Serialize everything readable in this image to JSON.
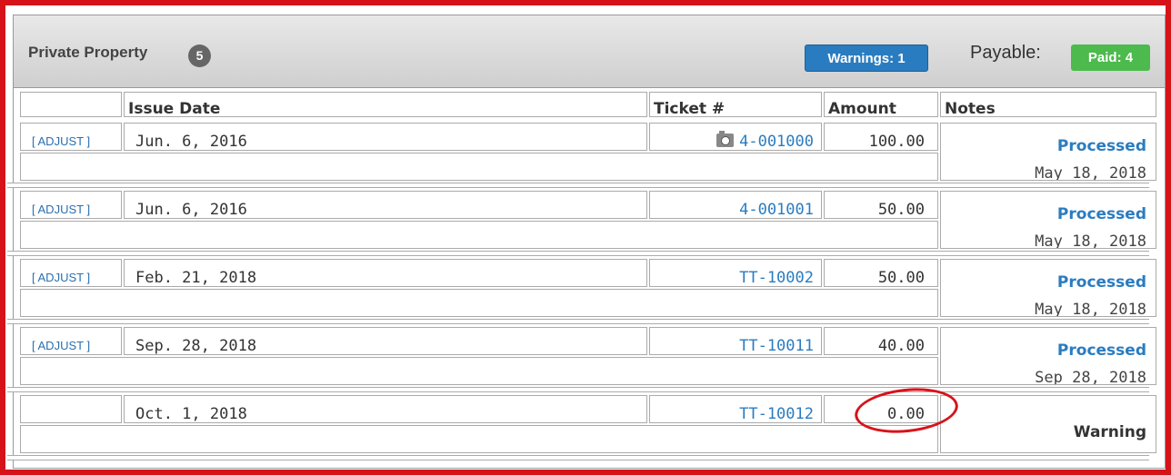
{
  "header": {
    "title": "Private Property",
    "count": "5",
    "warnings_label": "Warnings: 1",
    "payable_label": "Payable:",
    "paid_label": "Paid: 4"
  },
  "columns": {
    "blank": "",
    "issue_date": "Issue Date",
    "ticket": "Ticket #",
    "amount": "Amount",
    "notes": "Notes"
  },
  "rows": [
    {
      "adjust": "[ ADJUST ]",
      "issue_date": "Jun. 6, 2016",
      "ticket": "4-001000",
      "has_photo": true,
      "amount": "100.00",
      "status": "Processed",
      "status_date": "May 18, 2018"
    },
    {
      "adjust": "[ ADJUST ]",
      "issue_date": "Jun. 6, 2016",
      "ticket": "4-001001",
      "has_photo": false,
      "amount": "50.00",
      "status": "Processed",
      "status_date": "May 18, 2018"
    },
    {
      "adjust": "[ ADJUST ]",
      "issue_date": "Feb. 21, 2018",
      "ticket": "TT-10002",
      "has_photo": false,
      "amount": "50.00",
      "status": "Processed",
      "status_date": "May 18, 2018"
    },
    {
      "adjust": "[ ADJUST ]",
      "issue_date": "Sep. 28, 2018",
      "ticket": "TT-10011",
      "has_photo": false,
      "amount": "40.00",
      "status": "Processed",
      "status_date": "Sep 28, 2018"
    },
    {
      "adjust": "",
      "issue_date": "Oct. 1, 2018",
      "ticket": "TT-10012",
      "has_photo": false,
      "amount": "0.00",
      "status": "Warning",
      "status_date": ""
    }
  ],
  "colors": {
    "frame": "#d7131a",
    "link": "#2a7cc0",
    "warnings_badge": "#2a7cc0",
    "paid_badge": "#4cba4c"
  }
}
